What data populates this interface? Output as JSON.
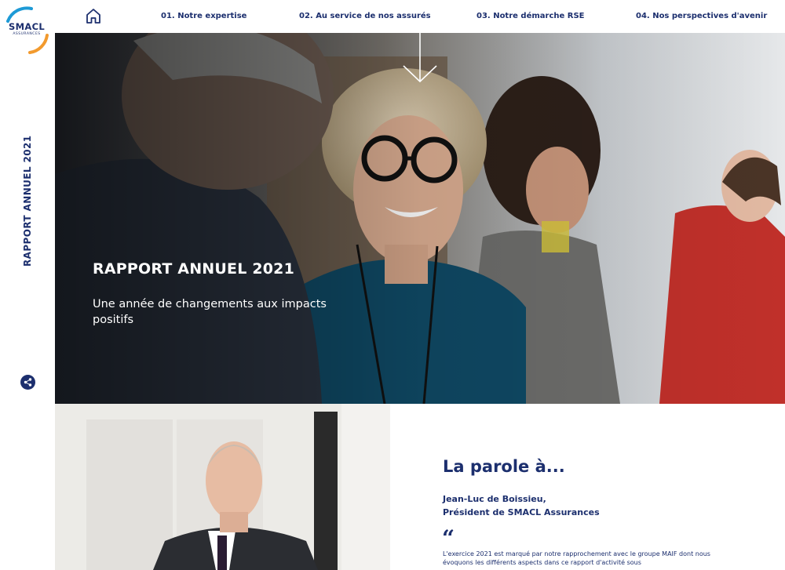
{
  "brand": {
    "name": "SMACL",
    "subname": "ASSURANCES",
    "primary_color": "#1c2f6e",
    "accent_blue": "#1d9ad6",
    "accent_orange": "#f29a2e"
  },
  "sidebar": {
    "vertical_title": "RAPPORT ANNUEL 2021",
    "share_icon": "share-icon"
  },
  "nav": {
    "home_icon": "home-icon",
    "items": [
      {
        "label": "01. Notre expertise"
      },
      {
        "label": "02. Au service de nos assurés"
      },
      {
        "label": "03. Notre démarche RSE"
      },
      {
        "label": "04. Nos perspectives d'avenir"
      }
    ]
  },
  "hero": {
    "title": "RAPPORT ANNUEL 2021",
    "subtitle": "Une année de changements aux impacts positifs",
    "scroll_icon": "arrow-down-icon"
  },
  "intro": {
    "heading": "La parole à...",
    "speaker_name": "Jean-Luc de Boissieu,",
    "speaker_role": "Président de SMACL Assurances",
    "quote_mark": "“",
    "quote": "L'exercice 2021 est marqué par notre rapprochement avec le groupe MAIF dont nous évoquons les différents aspects dans ce rapport d'activité sous"
  }
}
